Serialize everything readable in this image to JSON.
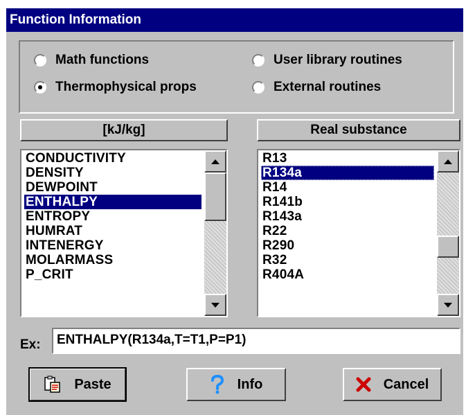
{
  "window": {
    "title": "Function Information"
  },
  "function_type": {
    "options": [
      {
        "label": "Math functions",
        "selected": false
      },
      {
        "label": "User library routines",
        "selected": false
      },
      {
        "label": "Thermophysical props",
        "selected": true
      },
      {
        "label": "External routines",
        "selected": false
      }
    ]
  },
  "units_button": {
    "label": "[kJ/kg]"
  },
  "substance_button": {
    "label": "Real substance"
  },
  "functions_list": {
    "items": [
      "CONDUCTIVITY",
      "DENSITY",
      "DEWPOINT",
      "ENTHALPY",
      "ENTROPY",
      "HUMRAT",
      "INTENERGY",
      "MOLARMASS",
      "P_CRIT"
    ],
    "selected": "ENTHALPY"
  },
  "substances_list": {
    "items": [
      "R13",
      "R134a",
      "R14",
      "R141b",
      "R143a",
      "R22",
      "R290",
      "R32",
      "R404A"
    ],
    "selected": "R134a"
  },
  "example": {
    "label": "Ex:",
    "value": "ENTHALPY(R134a,T=T1,P=P1)"
  },
  "buttons": {
    "paste": "Paste",
    "info": "Info",
    "cancel": "Cancel"
  },
  "colors": {
    "title_bar": "#000080",
    "selection": "#000080",
    "dialog": "#c0c0c0",
    "info_icon": "#1e90ff",
    "cancel_icon": "#cc0000"
  },
  "icons": {
    "paste": "paste-clipboard-icon",
    "info": "question-mark-icon",
    "cancel": "red-x-icon"
  }
}
